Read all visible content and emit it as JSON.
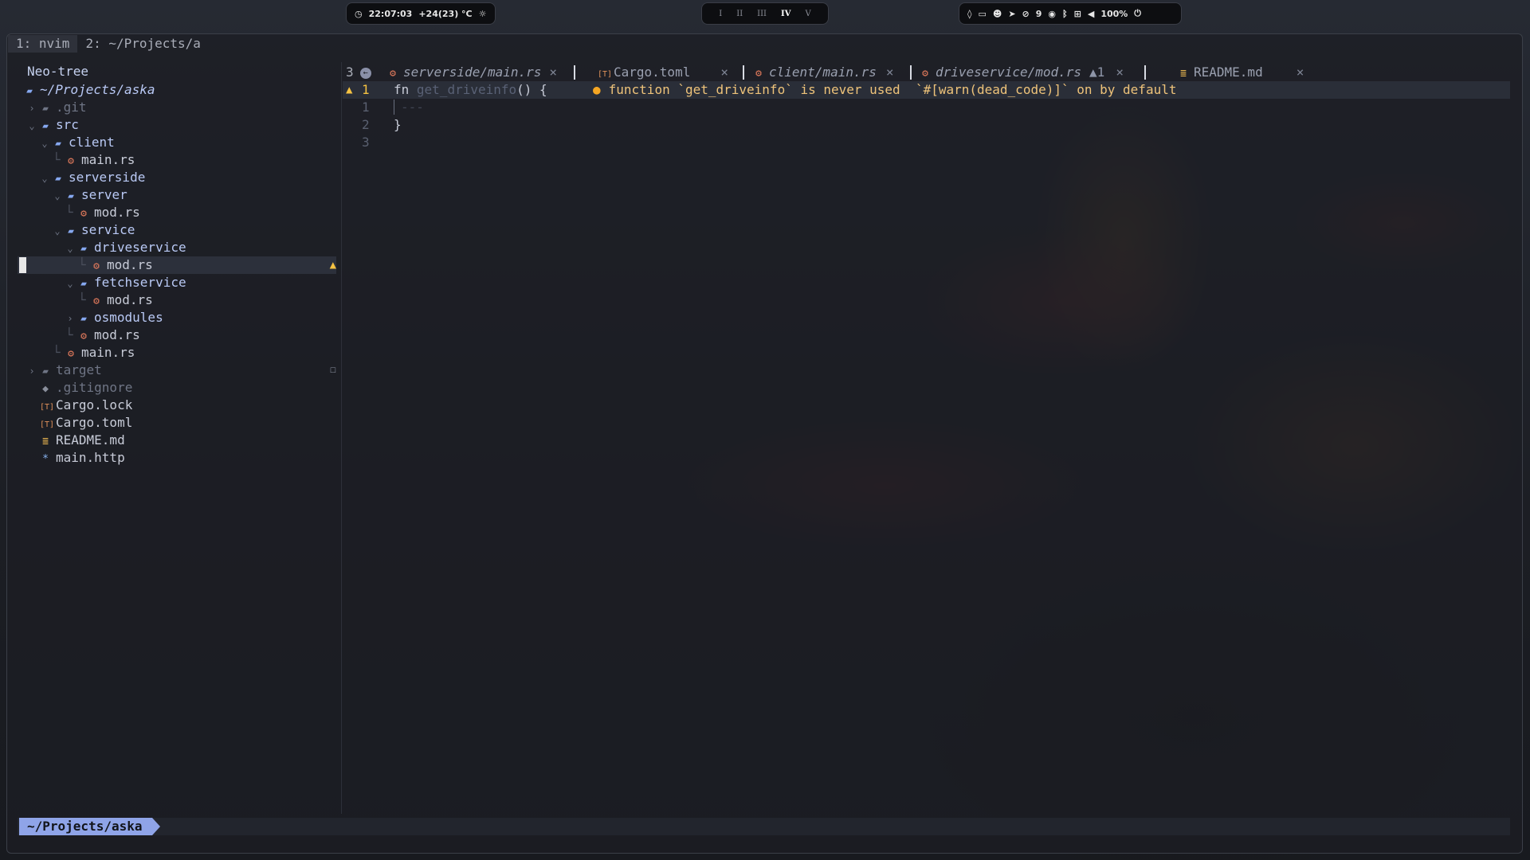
{
  "topbar": {
    "clock": "22:07:03",
    "weather": "+24(23) °C",
    "workspaces": [
      "I",
      "II",
      "III",
      "IV",
      "V"
    ],
    "active_workspace": "IV",
    "notifications": "9",
    "volume": "100%"
  },
  "tmux": {
    "windows": [
      "1: nvim",
      "2: ~/Projects/a"
    ]
  },
  "tree": {
    "title": "Neo-tree",
    "root": "~/Projects/aska",
    "items": [
      {
        "label": ".git",
        "type": "dir",
        "depth": 0,
        "open": false,
        "dim": true
      },
      {
        "label": "src",
        "type": "dir",
        "depth": 0,
        "open": true
      },
      {
        "label": "client",
        "type": "dir",
        "depth": 1,
        "open": true
      },
      {
        "label": "main.rs",
        "type": "rs",
        "depth": 2
      },
      {
        "label": "serverside",
        "type": "dir",
        "depth": 1,
        "open": true
      },
      {
        "label": "server",
        "type": "dir",
        "depth": 2,
        "open": true
      },
      {
        "label": "mod.rs",
        "type": "rs",
        "depth": 3
      },
      {
        "label": "service",
        "type": "dir",
        "depth": 2,
        "open": true
      },
      {
        "label": "driveservice",
        "type": "dir",
        "depth": 3,
        "open": true
      },
      {
        "label": "mod.rs",
        "type": "rs",
        "depth": 4,
        "selected": true,
        "warning": true
      },
      {
        "label": "fetchservice",
        "type": "dir",
        "depth": 3,
        "open": true
      },
      {
        "label": "mod.rs",
        "type": "rs",
        "depth": 4
      },
      {
        "label": "osmodules",
        "type": "dir",
        "depth": 3,
        "open": false
      },
      {
        "label": "mod.rs",
        "type": "rs",
        "depth": 3
      },
      {
        "label": "main.rs",
        "type": "rs",
        "depth": 2
      },
      {
        "label": "target",
        "type": "dir",
        "depth": 0,
        "open": false,
        "dim": true,
        "modified": true
      },
      {
        "label": ".gitignore",
        "type": "git",
        "depth": 0,
        "dim": true
      },
      {
        "label": "Cargo.lock",
        "type": "toml",
        "depth": 0
      },
      {
        "label": "Cargo.toml",
        "type": "toml",
        "depth": 0
      },
      {
        "label": "README.md",
        "type": "md",
        "depth": 0
      },
      {
        "label": "main.http",
        "type": "http",
        "depth": 0
      }
    ]
  },
  "tabs": {
    "hidden_count": "3",
    "items": [
      {
        "label": "serverside/main.rs",
        "icon": "rust-icon",
        "italic": true,
        "close": "×"
      },
      {
        "label": "Cargo.toml",
        "icon": "toml-icon",
        "italic": false,
        "close": "×"
      },
      {
        "label": "client/main.rs",
        "icon": "rust-icon",
        "italic": true,
        "close": "×"
      },
      {
        "label": "driveservice/mod.rs",
        "icon": "rust-icon",
        "italic": true,
        "close": "×",
        "warnings": "1",
        "active": true
      },
      {
        "label": "README.md",
        "icon": "markdown-icon",
        "italic": false,
        "close": "×"
      }
    ]
  },
  "editor": {
    "line_numbers": [
      "1",
      "1",
      "2",
      "3"
    ],
    "code": {
      "line1_kw": "fn",
      "line1_name": "get_driveinfo",
      "line1_rest": "() {",
      "line2": "---",
      "line3": "}"
    },
    "diagnostic": "function `get_driveinfo` is never used  `#[warn(dead_code)]` on by default"
  },
  "statusline": {
    "path": "~/Projects/aska"
  },
  "colors": {
    "accent": "#8fa4e8",
    "warning": "#f5c242",
    "rust": "#e27a5c"
  }
}
